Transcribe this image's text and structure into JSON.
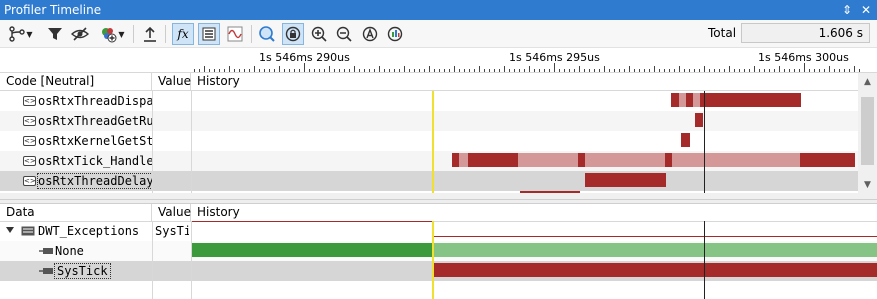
{
  "window": {
    "title": "Profiler Timeline",
    "pin_glyph": "⇕",
    "close_glyph": "✕"
  },
  "toolbar": {
    "icons": [
      "branch-icon",
      "filter-icon",
      "hide-icon",
      "add-icon",
      "upload-icon",
      "fx-icon",
      "list-icon",
      "signal-icon",
      "zoom-fit-icon",
      "zoom-lock-icon",
      "zoom-in-icon",
      "zoom-out-icon",
      "zoom-all-icon",
      "zoom-range-icon"
    ],
    "fx_label": "fx",
    "total_label": "Total",
    "total_value": "1.606 s"
  },
  "ruler": {
    "ticks": [
      "1s 546ms 290us",
      "1s 546ms 295us",
      "1s 546ms 300us"
    ]
  },
  "code_panel": {
    "headers": {
      "code": "Code [Neutral]",
      "value": "Value",
      "history": "History"
    },
    "rows": [
      {
        "name": "osRtxThreadDispatch"
      },
      {
        "name": "osRtxThreadGetRunning"
      },
      {
        "name": "osRtxKernelGetState"
      },
      {
        "name": "osRtxTick_Handler"
      },
      {
        "name": "osRtxThreadDelay"
      }
    ]
  },
  "data_panel": {
    "headers": {
      "data": "Data",
      "value": "Value",
      "history": "History"
    },
    "rows": [
      {
        "name": "DWT_Exceptions",
        "value": "SysTick"
      },
      {
        "name": "None",
        "value": ""
      },
      {
        "name": "SysTick",
        "value": ""
      }
    ]
  },
  "colors": {
    "accent": "#2f7bd0",
    "active": "#a52a2a",
    "inactive": "#d49898",
    "green_dark": "#3c9a3c",
    "green_light": "#86c486",
    "cursor": "#f0e030"
  }
}
